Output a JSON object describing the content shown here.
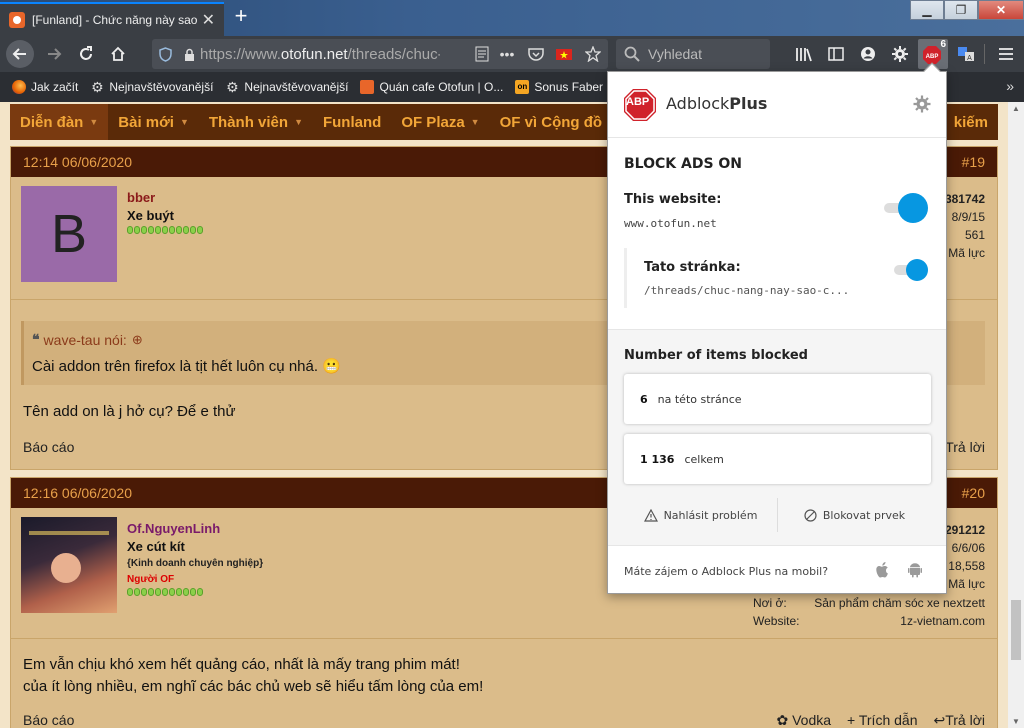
{
  "browser": {
    "tab_title": "[Funland] - Chức năng này sao c",
    "url_prefix": "https://www.",
    "url_domain": "otofun.net",
    "url_rest": "/threads/chuc-...",
    "search_placeholder": "Vyhledat",
    "abp_badge": "6",
    "bookmarks": [
      {
        "label": "Jak začít",
        "icon": "firefox-icon"
      },
      {
        "label": "Nejnavštěvovanější",
        "icon": "gear-icon"
      },
      {
        "label": "Nejnavštěvovanější",
        "icon": "gear-icon"
      },
      {
        "label": "Quán cafe Otofun | O...",
        "icon": "otofun-icon"
      },
      {
        "label": "Sonus Faber C",
        "icon": "on-icon"
      }
    ]
  },
  "site_nav": [
    "Diễn đàn",
    "Bài mới",
    "Thành viên",
    "Funland",
    "OF Plaza",
    "OF vì Cộng đồ",
    "kiếm"
  ],
  "posts": [
    {
      "date": "12:14 06/06/2020",
      "number": "#19",
      "avatar_letter": "B",
      "username": "bber",
      "user_title": "Xe buýt",
      "meta": [
        "381742",
        "8/9/15",
        "561",
        "Mã lực"
      ],
      "quote_author": "wave-tau nói:",
      "quote_text": "Cài addon trên firefox là tịt hết luôn cụ nhá. 😬",
      "body": "Tên add on là j hở cụ? Để e thử",
      "report": "Báo cáo",
      "reply": "Trả lời"
    },
    {
      "date": "12:16 06/06/2020",
      "number": "#20",
      "username": "Of.NguyenLinh",
      "user_title": "Xe cút kít",
      "user_subtitle": "{Kinh doanh chuyên nghiệp}",
      "user_badge": "Người OF",
      "meta": [
        "291212",
        "6/6/06",
        "18,558",
        "Mã lực"
      ],
      "place_label": "Nơi ở:",
      "place": "Sản phẩm chăm sóc xe nextzett",
      "website_label": "Website:",
      "website": "1z-vietnam.com",
      "body_line1": "Em vẫn chịu khó xem hết quảng cáo, nhất là mấy trang phim mát!",
      "body_line2": "của ít lòng nhiều, em nghĩ các bác chủ web sẽ hiểu tấm lòng của em!",
      "report": "Báo cáo",
      "vodka": "Vodka",
      "quote_btn": "+ Trích dẫn",
      "reply": "Trả lời"
    }
  ],
  "abp": {
    "logo_text": "ABP",
    "brand_light": "Adblock",
    "brand_bold": "Plus",
    "status": "BLOCK ADS ON",
    "website_label": "This website:",
    "website_domain": "www.otofun.net",
    "page_label": "Tato stránka:",
    "page_path": "/threads/chuc-nang-nay-sao-c...",
    "blocked_heading": "Number of items blocked",
    "page_count": "6",
    "page_count_label": "na této stránce",
    "total_count": "1 136",
    "total_count_label": "celkem",
    "report_issue": "Nahlásit problém",
    "block_element": "Blokovat prvek",
    "mobile_text": "Máte zájem o Adblock Plus na mobil?",
    "accent": "#0797e1",
    "logo_red": "#d0222b"
  }
}
